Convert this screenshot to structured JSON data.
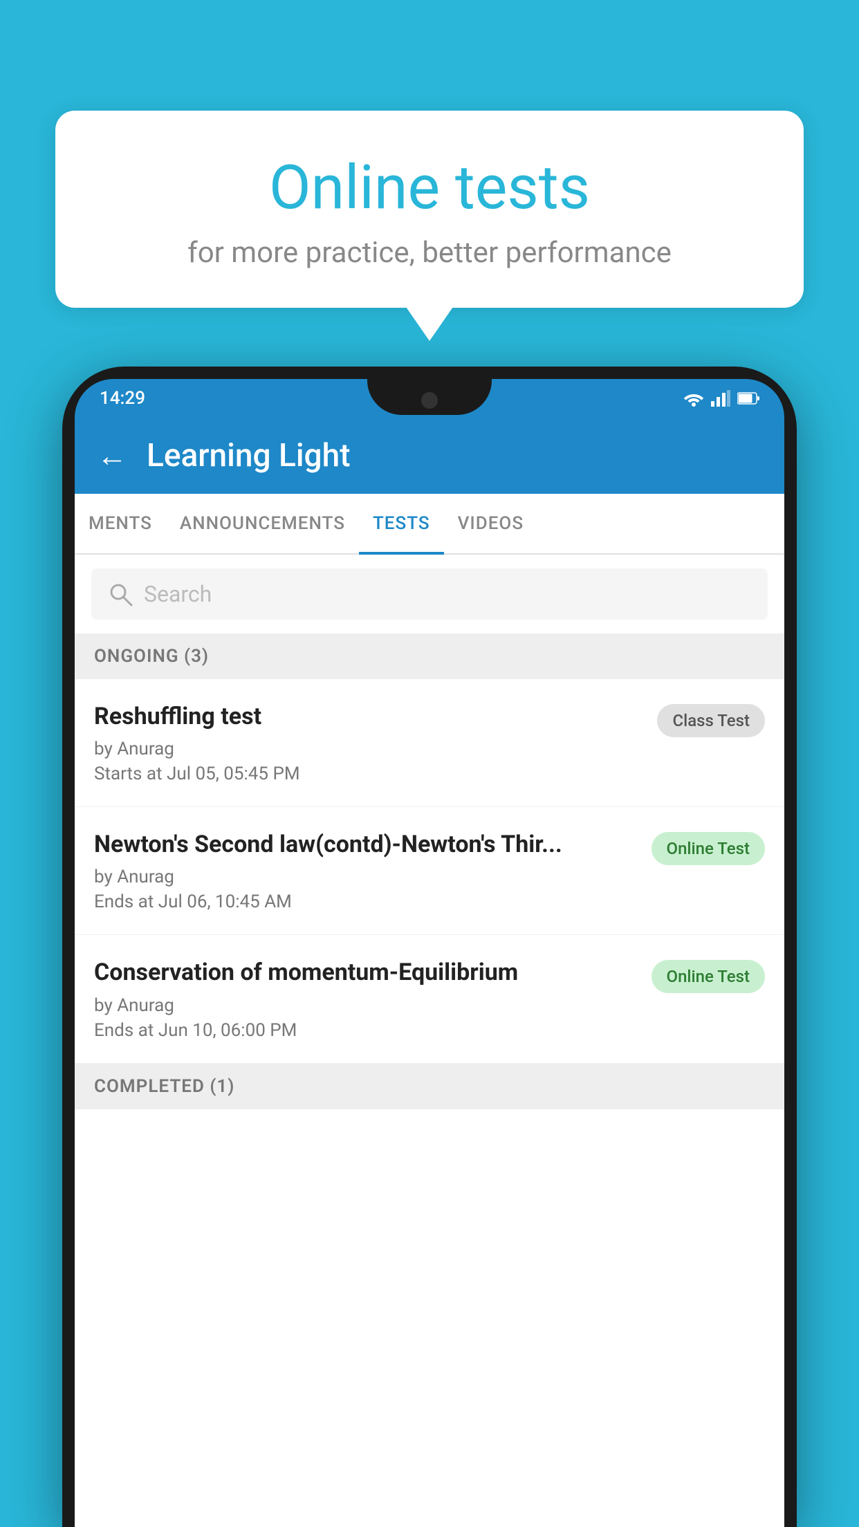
{
  "background_color": "#29b6d8",
  "bubble": {
    "title": "Online tests",
    "subtitle": "for more practice, better performance"
  },
  "phone": {
    "time": "14:29",
    "status_icons": [
      "wifi",
      "signal",
      "battery"
    ]
  },
  "app_bar": {
    "title": "Learning Light",
    "back_label": "←"
  },
  "tabs": [
    {
      "label": "MENTS",
      "active": false
    },
    {
      "label": "ANNOUNCEMENTS",
      "active": false
    },
    {
      "label": "TESTS",
      "active": true
    },
    {
      "label": "VIDEOS",
      "active": false
    }
  ],
  "search": {
    "placeholder": "Search"
  },
  "ongoing_section": {
    "label": "ONGOING (3)"
  },
  "test_items": [
    {
      "title": "Reshuffling test",
      "author": "by Anurag",
      "time_label": "Starts at",
      "time_value": "Jul 05, 05:45 PM",
      "badge": "Class Test",
      "badge_type": "class"
    },
    {
      "title": "Newton's Second law(contd)-Newton's Thir...",
      "author": "by Anurag",
      "time_label": "Ends at",
      "time_value": "Jul 06, 10:45 AM",
      "badge": "Online Test",
      "badge_type": "online"
    },
    {
      "title": "Conservation of momentum-Equilibrium",
      "author": "by Anurag",
      "time_label": "Ends at",
      "time_value": "Jun 10, 06:00 PM",
      "badge": "Online Test",
      "badge_type": "online"
    }
  ],
  "completed_section": {
    "label": "COMPLETED (1)"
  }
}
